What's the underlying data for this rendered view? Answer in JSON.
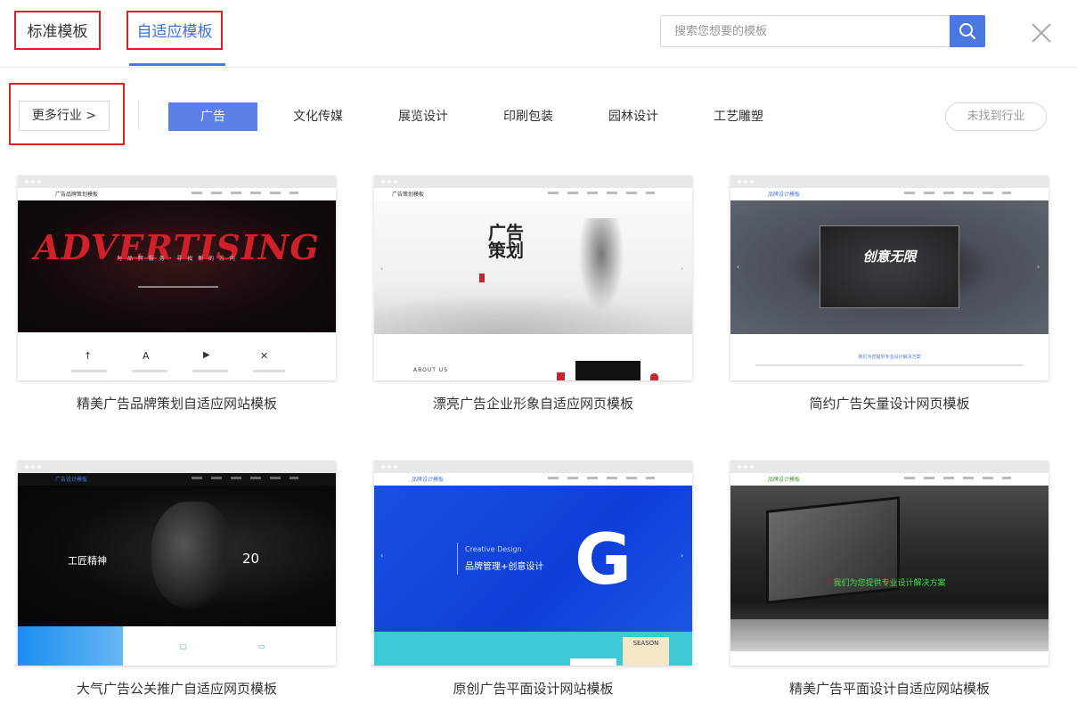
{
  "tabs": {
    "standard": "标准模板",
    "adaptive": "自适应模板"
  },
  "search": {
    "placeholder": "搜索您想要的模板"
  },
  "more_industries": "更多行业 >",
  "industries": [
    "广告",
    "文化传媒",
    "展览设计",
    "印刷包装",
    "园林设计",
    "工艺雕塑"
  ],
  "not_found": "未找到行业",
  "accent_color": "#4a78e0",
  "templates": [
    {
      "title": "精美广告品牌策划自适应网站模板",
      "brand": "广告品牌策划模板",
      "hero_text": "ADVERTISING",
      "hero_sub": "为 品 牌 服 务 · 寻 找 新 的 方 向"
    },
    {
      "title": "漂亮广告企业形象自适应网页模板",
      "brand": "广告策划模板",
      "hero_text": "广告策划",
      "hero_sub": "ABOUT US"
    },
    {
      "title": "简约广告矢量设计网页模板",
      "brand": "品牌设计模板",
      "hero_text": "创意无限",
      "hero_sub": "我们为您提供专业设计解决方案"
    },
    {
      "title": "大气广告公关推广自适应网页模板",
      "brand": "广告设计模板",
      "hero_text": "工匠精神",
      "hero_sub": "20"
    },
    {
      "title": "原创广告平面设计网站模板",
      "brand": "品牌设计模板",
      "hero_text": "品牌管理+创意设计",
      "hero_sub": "Creative Design"
    },
    {
      "title": "精美广告平面设计自适应网站模板",
      "brand": "品牌设计模板",
      "hero_text": "我们为您提供专业设计解决方案",
      "hero_sub": ""
    }
  ]
}
